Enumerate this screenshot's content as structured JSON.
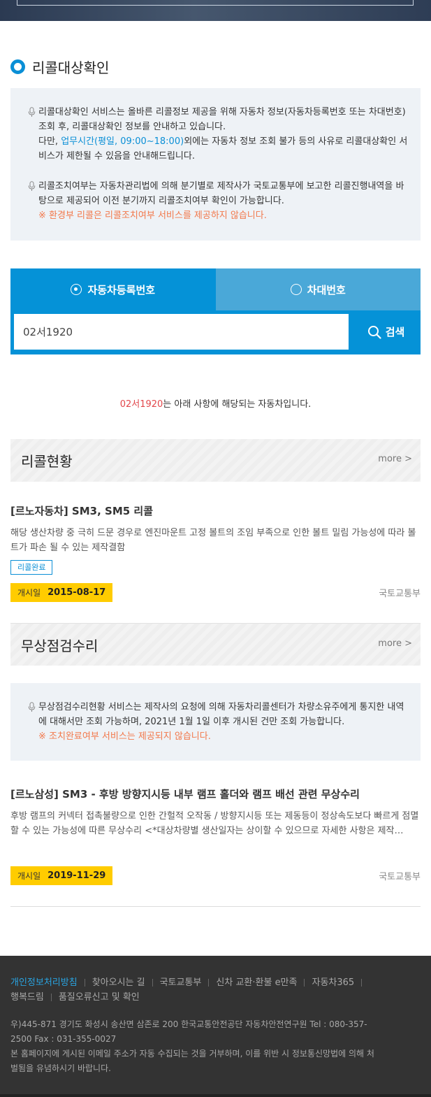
{
  "section": {
    "title": "리콜대상확인"
  },
  "notice1": {
    "p1_a": "리콜대상확인 서비스는 올바른 리콜정보 제공을 위해 자동차 정보(자동차등록번호 또는 차대번호) 조회 후, 리콜대상확인 정보를 안내하고 있습니다.",
    "p1_b_prefix": "다만, ",
    "p1_b_hours": "업무시간(평일, 09:00~18:00)",
    "p1_b_suffix": "외에는 자동차 정보 조회 불가 등의 사유로 리콜대상확인 서비스가 제한될 수 있음을 안내해드립니다.",
    "p2": "리콜조치여부는 자동차관리법에 의해 분기별로 제작사가 국토교통부에 보고한 리콜진행내역을 바탕으로 제공되어 이전 분기까지 리콜조치여부 확인이 가능합니다.",
    "p2_warn": "※ 환경부 리콜은 리콜조치여부 서비스를 제공하지 않습니다."
  },
  "tabs": [
    {
      "label": "자동차등록번호",
      "active": true
    },
    {
      "label": "차대번호",
      "active": false
    }
  ],
  "search": {
    "value": "02서1920",
    "button_label": "검색"
  },
  "result": {
    "plate": "02서1920",
    "suffix": "는 아래 사항에 해당되는 자동차입니다."
  },
  "recall": {
    "header": "리콜현황",
    "more": "more >",
    "item": {
      "title": "[르노자동차] SM3, SM5 리콜",
      "desc": "해당 생산차량 중 극히 드문 경우로 엔진마운트 고정 볼트의 조임 부족으로 인한 볼트 밀림 가능성에 따라 볼트가 파손 될 수 있는 제작결함",
      "status": "리콜완료",
      "date_label": "개시일",
      "date": "2015-08-17",
      "agency": "국토교통부"
    }
  },
  "free_repair": {
    "header": "무상점검수리",
    "more": "more >",
    "notice": "무상점검수리현황 서비스는 제작사의 요청에 의해 자동차리콜센터가 차량소유주에게 통지한 내역에 대해서만 조회 가능하며, 2021년 1월 1일 이후 개시된 건만 조회 가능합니다.",
    "notice_warn": "※ 조치완료여부 서비스는 제공되지 않습니다.",
    "item": {
      "title": "[르노삼성] SM3 - 후방 방향지시등 내부 램프 홀더와 램프 배선 관련 무상수리",
      "desc": "후방 램프의 커넥터 접촉불량으로 인한 간헐적 오작동 / 방향지시등 또는 제동등이 정상속도보다 빠르게 점멸할 수 있는 가능성에 따른 무상수리 <*대상차량별 생산일자는 상이할 수 있으므로 자세한 사항은 제작…",
      "date_label": "개시일",
      "date": "2019-11-29",
      "agency": "국토교통부"
    }
  },
  "footer": {
    "links": [
      "개인정보처리방침",
      "찾아오시는 길",
      "국토교통부",
      "신차 교환·환불 e만족",
      "자동차365",
      "행복드림",
      "품질오류신고 및 확인"
    ],
    "address": "우)445-871 경기도 화성시 송산면 삼존로 200 한국교통안전공단 자동차안전연구원 Tel : 080-357-2500 Fax : 031-355-0027",
    "notice": "본 홈페이지에 게시된 이메일 주소가 자동 수집되는 것을 거부하며, 이를 위반 시 정보통신망법에 의해 처벌됨을 유념하시기 바랍니다."
  },
  "colors": {
    "primary": "#0592d7",
    "tab_inactive": "#4aa8d8",
    "highlight": "#ffcc00",
    "warning": "#f2784b",
    "plate": "#e2474b",
    "footer_bg": "#333333"
  }
}
